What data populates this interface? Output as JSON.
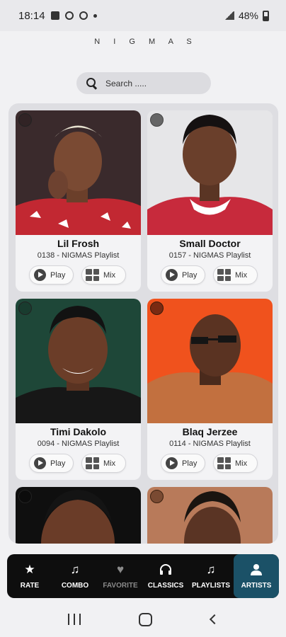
{
  "status_bar": {
    "time": "18:14",
    "battery": "48%",
    "icons": [
      "image-icon",
      "gear-icon",
      "settings-icon",
      "dot-icon",
      "signal-icon",
      "battery-icon"
    ]
  },
  "app": {
    "title": "N I G M A S"
  },
  "search": {
    "placeholder": "Search ....."
  },
  "artists": [
    {
      "name": "Lil Frosh",
      "subtitle": "0138 - NIGMAS Playlist",
      "play_label": "Play",
      "mix_label": "Mix",
      "bg": "#b7262e"
    },
    {
      "name": "Small Doctor",
      "subtitle": "0157 - NIGMAS Playlist",
      "play_label": "Play",
      "mix_label": "Mix",
      "bg": "#e8e8ea"
    },
    {
      "name": "Timi Dakolo",
      "subtitle": "0094 - NIGMAS Playlist",
      "play_label": "Play",
      "mix_label": "Mix",
      "bg": "#1f4a3a"
    },
    {
      "name": "Blaq Jerzee",
      "subtitle": "0114 - NIGMAS Playlist",
      "play_label": "Play",
      "mix_label": "Mix",
      "bg": "#f2541f"
    },
    {
      "name": "",
      "subtitle": "",
      "play_label": "",
      "mix_label": "",
      "bg": "#111111"
    },
    {
      "name": "",
      "subtitle": "",
      "play_label": "",
      "mix_label": "",
      "bg": "#b87a5a"
    }
  ],
  "bottom_nav": [
    {
      "label": "RATE",
      "icon": "star-icon",
      "state": "normal"
    },
    {
      "label": "COMBO",
      "icon": "music-note-icon",
      "state": "normal"
    },
    {
      "label": "FAVORITE",
      "icon": "heart-icon",
      "state": "muted"
    },
    {
      "label": "CLASSICS",
      "icon": "headphones-icon",
      "state": "normal"
    },
    {
      "label": "PLAYLISTS",
      "icon": "music-notes-icon",
      "state": "normal"
    },
    {
      "label": "ARTISTS",
      "icon": "person-icon",
      "state": "active"
    }
  ],
  "colors": {
    "nav_bg": "#0e0e0e",
    "nav_active": "#1b5167",
    "panel": "#dedee2"
  }
}
